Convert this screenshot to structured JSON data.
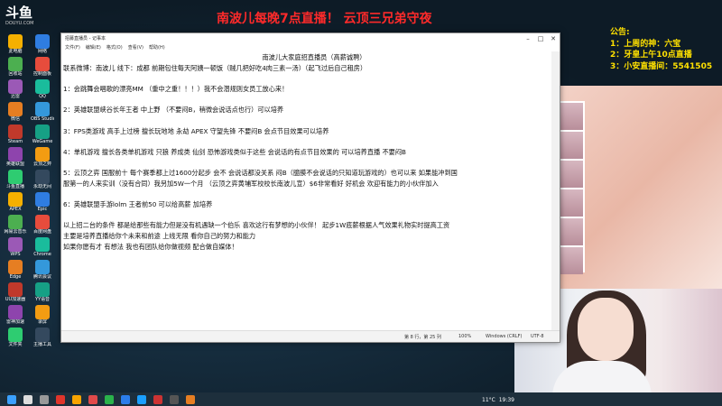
{
  "stream": {
    "logo": "斗鱼",
    "logo_sub": "DOUYU.COM",
    "banner": "南波儿每晚7点直播！ 云顶三兄弟守夜"
  },
  "notice": {
    "title": "公告:",
    "lines": [
      "1：上周的神：六宝",
      "2：牙皇上午10点直播",
      "3：小安直播间：5541505"
    ]
  },
  "notepad": {
    "title": "招募直播员 - 记事本",
    "menu": [
      "文件(F)",
      "编辑(E)",
      "格式(O)",
      "查看(V)",
      "帮助(H)"
    ],
    "lines": [
      "南波儿大家庭招直播员（高薪诚聘）",
      "联系微博：南波儿      线下：成都  前期包住每天阿姨一顿饭（贼几把好吃4肉三素一汤）（起飞过后自己租房）",
      "1：会跳舞会唱歌的漂亮MM  （重中之重！！！）我不会潜规则女员工放心来！",
      "2：英雄联盟峡谷长年王者  中上野  （不要闷B，稍微会说话点也行）可以培养",
      "3：FPS类游戏  高手上过榜  擅长玩地地  永劫   APEX  守望先锋  不要闷B 会点节目效果可以培养",
      "4：单机游戏  擅长各类单机游戏  只狼  养成类  仙剑 恐怖游戏类似于这些   会说话的有点节目效果的 可以培养直播 不要闷B",
      "5：云顶之弈  国服前十  每个赛季都上过1600分起步  会不  会说话都没关系 闷B（臆膜不会说话的只知道玩游戏的）也可以来    如果能冲到国",
      "服第一的人来实训（没有合同）我另加5W一个月   （云顶之弈黄埔军校校长南波儿宣）$6非常看好  好机会 欢迎有能力的小伙伴加入",
      "6：英雄联盟手游lolm  王者前50  可以给高薪  加培养",
      "以上招二台的条件  都是给那些有能力但是没有机遇缺一个伯乐  喜欢这行有梦想的小伙伴！   起步1W底薪根据人气效果礼物实时提高工资",
      "主要是培养直播给你个未来和前途 上线无限 看你自己的努力和能力",
      "如果你愿有才 有想法  我也有团队给你做视频 配合做自媒体！"
    ],
    "status": {
      "position": "第 8 行，第 25 列",
      "zoom": "100%",
      "eol": "Windows (CRLF)",
      "encoding": "UTF-8"
    }
  },
  "taskbar": {
    "weather": "11°C",
    "time": "19:39"
  },
  "desktop_icons": [
    "此电脑",
    "网络",
    "回收站",
    "控制面板",
    "迅雷",
    "QQ",
    "微信",
    "OBS Studio",
    "Steam",
    "WeGame",
    "英雄联盟",
    "云顶之弈",
    "斗鱼直播",
    "永劫无间",
    "APEX",
    "Epic",
    "网易云音乐",
    "百度网盘",
    "WPS",
    "Chrome",
    "Edge",
    "腾讯会议",
    "UU加速器",
    "YY语音",
    "雷神加速",
    "录屏",
    "文件夹",
    "主播工具"
  ],
  "colors": {
    "banner": "#ff2a2a",
    "notice": "#ffe100",
    "taskbar": "#1d2f3c"
  }
}
